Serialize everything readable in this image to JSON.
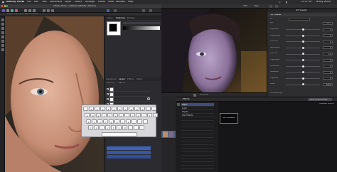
{
  "menubar": {
    "apple": "",
    "items": [
      "Affinity Photo",
      "File",
      "Edit",
      "Text",
      "Document",
      "Layer",
      "Select",
      "Arrange",
      "Filters",
      "View",
      "Window",
      "Help"
    ],
    "clock": "12:32 PM",
    "user": "Brady Wurtz"
  },
  "affinity": {
    "title": "Affinity Photo - Untitled (CMYK/8) (100.0%)",
    "context_hint": "Drag on canvas to select an area",
    "panel_tabs_top": [
      "Colour",
      "Swatches",
      "Brushes"
    ],
    "panel_tabs_layers": [
      "Adjustment",
      "Layers",
      "Effects",
      "Styles"
    ],
    "layers": [
      {
        "name": "",
        "selected": false
      },
      {
        "name": "",
        "selected": false
      },
      {
        "name": "",
        "selected": false
      },
      {
        "name": "",
        "selected": false
      },
      {
        "name": "",
        "selected": true
      }
    ],
    "background_layer": "Background",
    "opacity_label": "Opacity:",
    "opacity_value": "100 %",
    "dropdown_rows": [
      "",
      "",
      ""
    ],
    "colors": {
      "accent": "#3d63b8",
      "selected_layer": "#3d5f9c"
    }
  },
  "keyboard": {
    "rows": [
      [
        "`",
        "1",
        "2",
        "3",
        "4",
        "5",
        "6",
        "7",
        "8",
        "9",
        "0",
        "-",
        "="
      ],
      [
        "q",
        "w",
        "e",
        "r",
        "t",
        "y",
        "u",
        "i",
        "o",
        "p",
        "[",
        "]",
        "\\"
      ],
      [
        "a",
        "s",
        "d",
        "f",
        "g",
        "h",
        "j",
        "k",
        "l",
        ";",
        "'"
      ],
      [
        "z",
        "x",
        "c",
        "v",
        "b",
        "n",
        "m",
        ",",
        ".",
        "/"
      ]
    ],
    "space_label": ""
  },
  "fcp": {
    "zoom_label": "33%",
    "view_label": "View",
    "inspector_title": "LUT Loader",
    "inspector_fields": [
      {
        "label": "LUT",
        "value": ""
      },
      {
        "label": "Mix",
        "value": "100.0"
      }
    ],
    "sliders": [
      {
        "label": "Exposure",
        "value": "0",
        "pos": 0.5
      },
      {
        "label": "Brightness",
        "value": "0",
        "pos": 0.5
      },
      {
        "label": "Contrast",
        "value": "0",
        "pos": 0.5
      },
      {
        "label": "Saturation",
        "value": "0",
        "pos": 0.5
      },
      {
        "label": "Gamma",
        "value": "1.0",
        "pos": 0.5
      },
      {
        "label": "Highlights",
        "value": "0",
        "pos": 0.5
      },
      {
        "label": "Midtones",
        "value": "0",
        "pos": 0.5
      },
      {
        "label": "Shadows",
        "value": "0",
        "pos": 0.5
      },
      {
        "label": "Vignette",
        "value": "0",
        "pos": 0.5
      },
      {
        "label": "Fade",
        "value": "100.0",
        "pos": 0.5
      }
    ],
    "compositing_label": "Compositing",
    "save_button": "Save Effects Preset",
    "viewer_timecode": "00:00:00",
    "clip_label": "",
    "effects_title": "Effects",
    "installed_effects": "Installed Effects",
    "effects_categories": [
      "Color",
      "Light",
      "Stylize",
      "Text Effects",
      "",
      "",
      "",
      "",
      "",
      "",
      "",
      "",
      "",
      "",
      "",
      "",
      "",
      "",
      "",
      ""
    ],
    "effect_preview_label": "LUT LOADER",
    "colors": {
      "selection": "#3b4e7c",
      "button": "#4a4a4e"
    }
  }
}
